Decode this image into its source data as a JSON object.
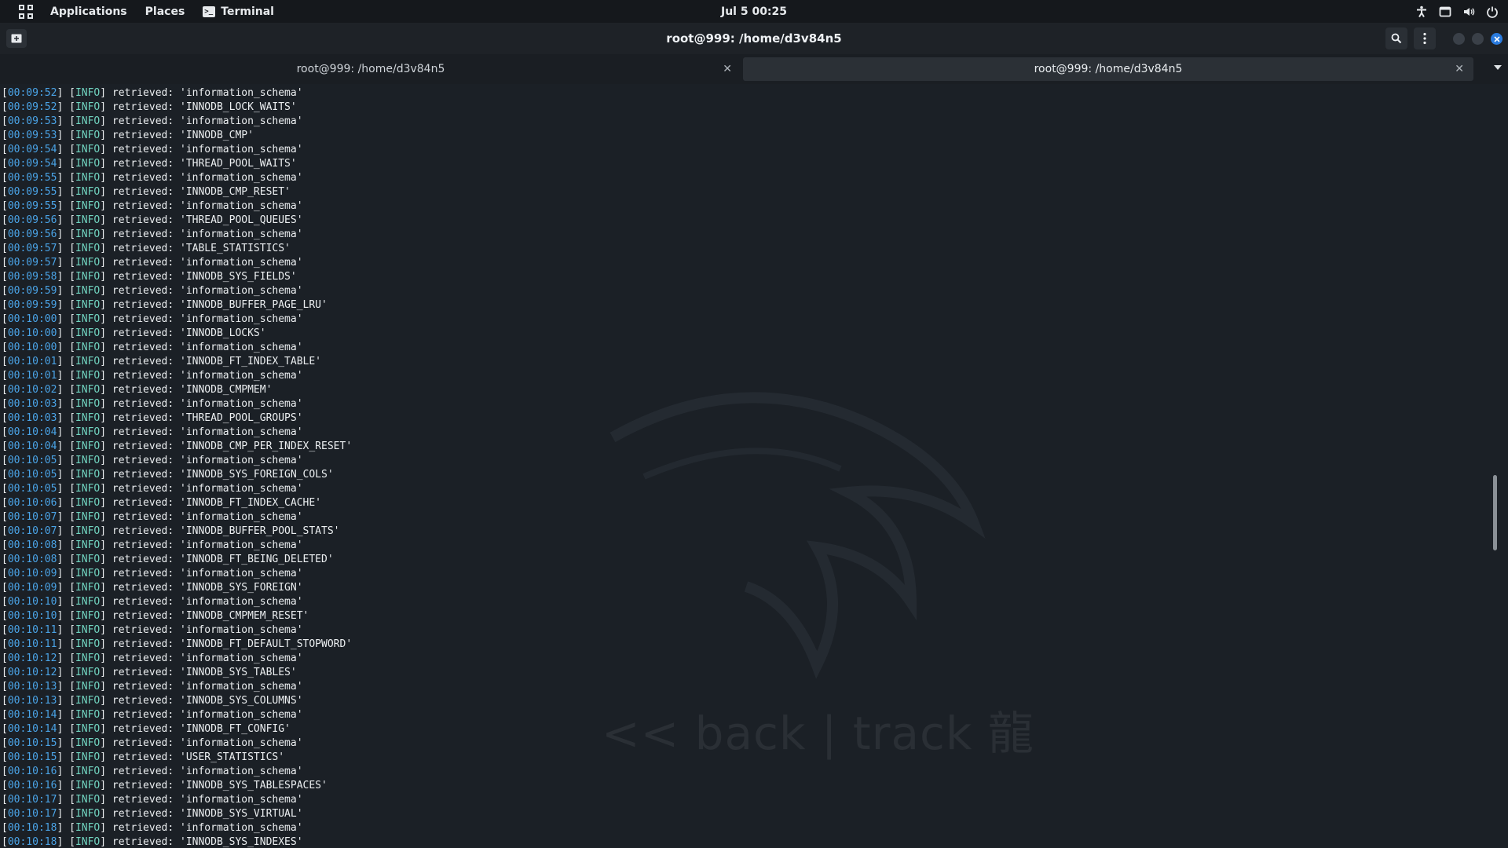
{
  "topbar": {
    "applications": "Applications",
    "places": "Places",
    "terminal_app": "Terminal",
    "clock": "Jul 5  00:25"
  },
  "titlebar": {
    "title": "root@999: /home/d3v84n5"
  },
  "tabs": [
    {
      "label": "root@999: /home/d3v84n5",
      "active": false
    },
    {
      "label": "root@999: /home/d3v84n5",
      "active": true
    }
  ],
  "watermark": {
    "text": "<< back | track 龍"
  },
  "log": [
    {
      "time": "00:09:52",
      "level": "INFO",
      "msg": "retrieved: 'information_schema'"
    },
    {
      "time": "00:09:52",
      "level": "INFO",
      "msg": "retrieved: 'INNODB_LOCK_WAITS'"
    },
    {
      "time": "00:09:53",
      "level": "INFO",
      "msg": "retrieved: 'information_schema'"
    },
    {
      "time": "00:09:53",
      "level": "INFO",
      "msg": "retrieved: 'INNODB_CMP'"
    },
    {
      "time": "00:09:54",
      "level": "INFO",
      "msg": "retrieved: 'information_schema'"
    },
    {
      "time": "00:09:54",
      "level": "INFO",
      "msg": "retrieved: 'THREAD_POOL_WAITS'"
    },
    {
      "time": "00:09:55",
      "level": "INFO",
      "msg": "retrieved: 'information_schema'"
    },
    {
      "time": "00:09:55",
      "level": "INFO",
      "msg": "retrieved: 'INNODB_CMP_RESET'"
    },
    {
      "time": "00:09:55",
      "level": "INFO",
      "msg": "retrieved: 'information_schema'"
    },
    {
      "time": "00:09:56",
      "level": "INFO",
      "msg": "retrieved: 'THREAD_POOL_QUEUES'"
    },
    {
      "time": "00:09:56",
      "level": "INFO",
      "msg": "retrieved: 'information_schema'"
    },
    {
      "time": "00:09:57",
      "level": "INFO",
      "msg": "retrieved: 'TABLE_STATISTICS'"
    },
    {
      "time": "00:09:57",
      "level": "INFO",
      "msg": "retrieved: 'information_schema'"
    },
    {
      "time": "00:09:58",
      "level": "INFO",
      "msg": "retrieved: 'INNODB_SYS_FIELDS'"
    },
    {
      "time": "00:09:59",
      "level": "INFO",
      "msg": "retrieved: 'information_schema'"
    },
    {
      "time": "00:09:59",
      "level": "INFO",
      "msg": "retrieved: 'INNODB_BUFFER_PAGE_LRU'"
    },
    {
      "time": "00:10:00",
      "level": "INFO",
      "msg": "retrieved: 'information_schema'"
    },
    {
      "time": "00:10:00",
      "level": "INFO",
      "msg": "retrieved: 'INNODB_LOCKS'"
    },
    {
      "time": "00:10:00",
      "level": "INFO",
      "msg": "retrieved: 'information_schema'"
    },
    {
      "time": "00:10:01",
      "level": "INFO",
      "msg": "retrieved: 'INNODB_FT_INDEX_TABLE'"
    },
    {
      "time": "00:10:01",
      "level": "INFO",
      "msg": "retrieved: 'information_schema'"
    },
    {
      "time": "00:10:02",
      "level": "INFO",
      "msg": "retrieved: 'INNODB_CMPMEM'"
    },
    {
      "time": "00:10:03",
      "level": "INFO",
      "msg": "retrieved: 'information_schema'"
    },
    {
      "time": "00:10:03",
      "level": "INFO",
      "msg": "retrieved: 'THREAD_POOL_GROUPS'"
    },
    {
      "time": "00:10:04",
      "level": "INFO",
      "msg": "retrieved: 'information_schema'"
    },
    {
      "time": "00:10:04",
      "level": "INFO",
      "msg": "retrieved: 'INNODB_CMP_PER_INDEX_RESET'"
    },
    {
      "time": "00:10:05",
      "level": "INFO",
      "msg": "retrieved: 'information_schema'"
    },
    {
      "time": "00:10:05",
      "level": "INFO",
      "msg": "retrieved: 'INNODB_SYS_FOREIGN_COLS'"
    },
    {
      "time": "00:10:05",
      "level": "INFO",
      "msg": "retrieved: 'information_schema'"
    },
    {
      "time": "00:10:06",
      "level": "INFO",
      "msg": "retrieved: 'INNODB_FT_INDEX_CACHE'"
    },
    {
      "time": "00:10:07",
      "level": "INFO",
      "msg": "retrieved: 'information_schema'"
    },
    {
      "time": "00:10:07",
      "level": "INFO",
      "msg": "retrieved: 'INNODB_BUFFER_POOL_STATS'"
    },
    {
      "time": "00:10:08",
      "level": "INFO",
      "msg": "retrieved: 'information_schema'"
    },
    {
      "time": "00:10:08",
      "level": "INFO",
      "msg": "retrieved: 'INNODB_FT_BEING_DELETED'"
    },
    {
      "time": "00:10:09",
      "level": "INFO",
      "msg": "retrieved: 'information_schema'"
    },
    {
      "time": "00:10:09",
      "level": "INFO",
      "msg": "retrieved: 'INNODB_SYS_FOREIGN'"
    },
    {
      "time": "00:10:10",
      "level": "INFO",
      "msg": "retrieved: 'information_schema'"
    },
    {
      "time": "00:10:10",
      "level": "INFO",
      "msg": "retrieved: 'INNODB_CMPMEM_RESET'"
    },
    {
      "time": "00:10:11",
      "level": "INFO",
      "msg": "retrieved: 'information_schema'"
    },
    {
      "time": "00:10:11",
      "level": "INFO",
      "msg": "retrieved: 'INNODB_FT_DEFAULT_STOPWORD'"
    },
    {
      "time": "00:10:12",
      "level": "INFO",
      "msg": "retrieved: 'information_schema'"
    },
    {
      "time": "00:10:12",
      "level": "INFO",
      "msg": "retrieved: 'INNODB_SYS_TABLES'"
    },
    {
      "time": "00:10:13",
      "level": "INFO",
      "msg": "retrieved: 'information_schema'"
    },
    {
      "time": "00:10:13",
      "level": "INFO",
      "msg": "retrieved: 'INNODB_SYS_COLUMNS'"
    },
    {
      "time": "00:10:14",
      "level": "INFO",
      "msg": "retrieved: 'information_schema'"
    },
    {
      "time": "00:10:14",
      "level": "INFO",
      "msg": "retrieved: 'INNODB_FT_CONFIG'"
    },
    {
      "time": "00:10:15",
      "level": "INFO",
      "msg": "retrieved: 'information_schema'"
    },
    {
      "time": "00:10:15",
      "level": "INFO",
      "msg": "retrieved: 'USER_STATISTICS'"
    },
    {
      "time": "00:10:16",
      "level": "INFO",
      "msg": "retrieved: 'information_schema'"
    },
    {
      "time": "00:10:16",
      "level": "INFO",
      "msg": "retrieved: 'INNODB_SYS_TABLESPACES'"
    },
    {
      "time": "00:10:17",
      "level": "INFO",
      "msg": "retrieved: 'information_schema'"
    },
    {
      "time": "00:10:17",
      "level": "INFO",
      "msg": "retrieved: 'INNODB_SYS_VIRTUAL'"
    },
    {
      "time": "00:10:18",
      "level": "INFO",
      "msg": "retrieved: 'information_schema'"
    },
    {
      "time": "00:10:18",
      "level": "INFO",
      "msg": "retrieved: 'INNODB_SYS_INDEXES'"
    }
  ]
}
